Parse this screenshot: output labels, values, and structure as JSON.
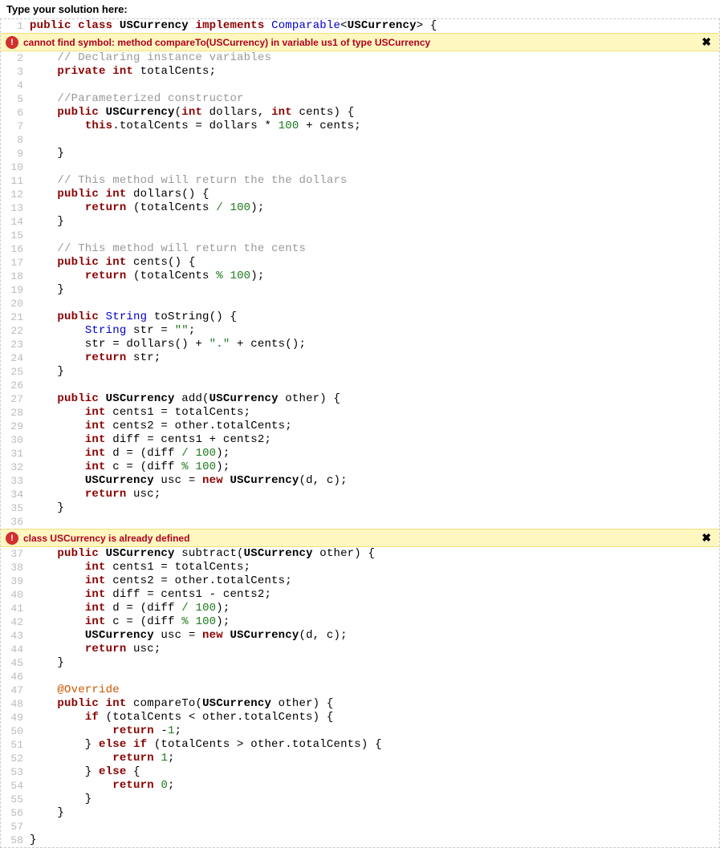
{
  "header": {
    "prompt": "Type your solution here:"
  },
  "errors": [
    {
      "message": "cannot find symbol: method compareTo(USCurrency) in variable us1 of type USCurrency",
      "after_line": 1
    },
    {
      "message": "class USCurrency is already defined",
      "after_line": 36
    }
  ],
  "close_glyph": "✖",
  "code_lines": [
    {
      "n": 1,
      "tokens": [
        [
          "kw",
          "public"
        ],
        [
          "",
          " "
        ],
        [
          "kw",
          "class"
        ],
        [
          "",
          " "
        ],
        [
          "darktyp",
          "USCurrency"
        ],
        [
          "",
          " "
        ],
        [
          "kw",
          "implements"
        ],
        [
          "",
          " "
        ],
        [
          "typ",
          "Comparable"
        ],
        [
          "",
          "<"
        ],
        [
          "darktyp",
          "USCurrency"
        ],
        [
          "",
          "> {"
        ]
      ]
    },
    {
      "n": 2,
      "tokens": [
        [
          "",
          "    "
        ],
        [
          "cmt",
          "// Declaring instance variables"
        ]
      ]
    },
    {
      "n": 3,
      "tokens": [
        [
          "",
          "    "
        ],
        [
          "kw",
          "private"
        ],
        [
          "",
          " "
        ],
        [
          "kw",
          "int"
        ],
        [
          "",
          " totalCents;"
        ]
      ]
    },
    {
      "n": 4,
      "tokens": []
    },
    {
      "n": 5,
      "tokens": [
        [
          "",
          "    "
        ],
        [
          "cmt",
          "//Parameterized constructor"
        ]
      ]
    },
    {
      "n": 6,
      "tokens": [
        [
          "",
          "    "
        ],
        [
          "kw",
          "public"
        ],
        [
          "",
          " "
        ],
        [
          "darktyp",
          "USCurrency"
        ],
        [
          "",
          "("
        ],
        [
          "kw",
          "int"
        ],
        [
          "",
          " dollars, "
        ],
        [
          "kw",
          "int"
        ],
        [
          "",
          " cents) {"
        ]
      ]
    },
    {
      "n": 7,
      "tokens": [
        [
          "",
          "        "
        ],
        [
          "kw",
          "this"
        ],
        [
          "",
          ".totalCents = dollars * "
        ],
        [
          "num",
          "100"
        ],
        [
          "",
          " + cents;"
        ]
      ]
    },
    {
      "n": 8,
      "tokens": []
    },
    {
      "n": 9,
      "tokens": [
        [
          "",
          "    }"
        ]
      ]
    },
    {
      "n": 10,
      "tokens": []
    },
    {
      "n": 11,
      "tokens": [
        [
          "",
          "    "
        ],
        [
          "cmt",
          "// This method will return the the dollars"
        ]
      ]
    },
    {
      "n": 12,
      "tokens": [
        [
          "",
          "    "
        ],
        [
          "kw",
          "public"
        ],
        [
          "",
          " "
        ],
        [
          "kw",
          "int"
        ],
        [
          "",
          " dollars() {"
        ]
      ]
    },
    {
      "n": 13,
      "tokens": [
        [
          "",
          "        "
        ],
        [
          "kw",
          "return"
        ],
        [
          "",
          " (totalCents "
        ],
        [
          "op",
          "/"
        ],
        [
          "",
          " "
        ],
        [
          "num",
          "100"
        ],
        [
          "",
          ");"
        ]
      ]
    },
    {
      "n": 14,
      "tokens": [
        [
          "",
          "    }"
        ]
      ]
    },
    {
      "n": 15,
      "tokens": []
    },
    {
      "n": 16,
      "tokens": [
        [
          "",
          "    "
        ],
        [
          "cmt",
          "// This method will return the cents"
        ]
      ]
    },
    {
      "n": 17,
      "tokens": [
        [
          "",
          "    "
        ],
        [
          "kw",
          "public"
        ],
        [
          "",
          " "
        ],
        [
          "kw",
          "int"
        ],
        [
          "",
          " cents() {"
        ]
      ]
    },
    {
      "n": 18,
      "tokens": [
        [
          "",
          "        "
        ],
        [
          "kw",
          "return"
        ],
        [
          "",
          " (totalCents "
        ],
        [
          "op",
          "%"
        ],
        [
          "",
          " "
        ],
        [
          "num",
          "100"
        ],
        [
          "",
          ");"
        ]
      ]
    },
    {
      "n": 19,
      "tokens": [
        [
          "",
          "    }"
        ]
      ]
    },
    {
      "n": 20,
      "tokens": []
    },
    {
      "n": 21,
      "tokens": [
        [
          "",
          "    "
        ],
        [
          "kw",
          "public"
        ],
        [
          "",
          " "
        ],
        [
          "typ",
          "String"
        ],
        [
          "",
          " toString() {"
        ]
      ]
    },
    {
      "n": 22,
      "tokens": [
        [
          "",
          "        "
        ],
        [
          "typ",
          "String"
        ],
        [
          "",
          " str = "
        ],
        [
          "str",
          "\"\""
        ],
        [
          "",
          ";"
        ]
      ]
    },
    {
      "n": 23,
      "tokens": [
        [
          "",
          "        str = dollars() + "
        ],
        [
          "str",
          "\".\""
        ],
        [
          "",
          " + cents();"
        ]
      ]
    },
    {
      "n": 24,
      "tokens": [
        [
          "",
          "        "
        ],
        [
          "kw",
          "return"
        ],
        [
          "",
          " str;"
        ]
      ]
    },
    {
      "n": 25,
      "tokens": [
        [
          "",
          "    }"
        ]
      ]
    },
    {
      "n": 26,
      "tokens": []
    },
    {
      "n": 27,
      "tokens": [
        [
          "",
          "    "
        ],
        [
          "kw",
          "public"
        ],
        [
          "",
          " "
        ],
        [
          "darktyp",
          "USCurrency"
        ],
        [
          "",
          " add("
        ],
        [
          "darktyp",
          "USCurrency"
        ],
        [
          "",
          " other) {"
        ]
      ]
    },
    {
      "n": 28,
      "tokens": [
        [
          "",
          "        "
        ],
        [
          "kw",
          "int"
        ],
        [
          "",
          " cents1 = totalCents;"
        ]
      ]
    },
    {
      "n": 29,
      "tokens": [
        [
          "",
          "        "
        ],
        [
          "kw",
          "int"
        ],
        [
          "",
          " cents2 = other.totalCents;"
        ]
      ]
    },
    {
      "n": 30,
      "tokens": [
        [
          "",
          "        "
        ],
        [
          "kw",
          "int"
        ],
        [
          "",
          " diff = cents1 + cents2;"
        ]
      ]
    },
    {
      "n": 31,
      "tokens": [
        [
          "",
          "        "
        ],
        [
          "kw",
          "int"
        ],
        [
          "",
          " d = (diff "
        ],
        [
          "op",
          "/"
        ],
        [
          "",
          " "
        ],
        [
          "num",
          "100"
        ],
        [
          "",
          ");"
        ]
      ]
    },
    {
      "n": 32,
      "tokens": [
        [
          "",
          "        "
        ],
        [
          "kw",
          "int"
        ],
        [
          "",
          " c = (diff "
        ],
        [
          "op",
          "%"
        ],
        [
          "",
          " "
        ],
        [
          "num",
          "100"
        ],
        [
          "",
          ");"
        ]
      ]
    },
    {
      "n": 33,
      "tokens": [
        [
          "",
          "        "
        ],
        [
          "darktyp",
          "USCurrency"
        ],
        [
          "",
          " usc = "
        ],
        [
          "kw",
          "new"
        ],
        [
          "",
          " "
        ],
        [
          "darktyp",
          "USCurrency"
        ],
        [
          "",
          "(d, c);"
        ]
      ]
    },
    {
      "n": 34,
      "tokens": [
        [
          "",
          "        "
        ],
        [
          "kw",
          "return"
        ],
        [
          "",
          " usc;"
        ]
      ]
    },
    {
      "n": 35,
      "tokens": [
        [
          "",
          "    }"
        ]
      ]
    },
    {
      "n": 36,
      "tokens": []
    },
    {
      "n": 37,
      "tokens": [
        [
          "",
          "    "
        ],
        [
          "kw",
          "public"
        ],
        [
          "",
          " "
        ],
        [
          "darktyp",
          "USCurrency"
        ],
        [
          "",
          " subtract("
        ],
        [
          "darktyp",
          "USCurrency"
        ],
        [
          "",
          " other) {"
        ]
      ]
    },
    {
      "n": 38,
      "tokens": [
        [
          "",
          "        "
        ],
        [
          "kw",
          "int"
        ],
        [
          "",
          " cents1 = totalCents;"
        ]
      ]
    },
    {
      "n": 39,
      "tokens": [
        [
          "",
          "        "
        ],
        [
          "kw",
          "int"
        ],
        [
          "",
          " cents2 = other.totalCents;"
        ]
      ]
    },
    {
      "n": 40,
      "tokens": [
        [
          "",
          "        "
        ],
        [
          "kw",
          "int"
        ],
        [
          "",
          " diff = cents1 - cents2;"
        ]
      ]
    },
    {
      "n": 41,
      "tokens": [
        [
          "",
          "        "
        ],
        [
          "kw",
          "int"
        ],
        [
          "",
          " d = (diff "
        ],
        [
          "op",
          "/"
        ],
        [
          "",
          " "
        ],
        [
          "num",
          "100"
        ],
        [
          "",
          ");"
        ]
      ]
    },
    {
      "n": 42,
      "tokens": [
        [
          "",
          "        "
        ],
        [
          "kw",
          "int"
        ],
        [
          "",
          " c = (diff "
        ],
        [
          "op",
          "%"
        ],
        [
          "",
          " "
        ],
        [
          "num",
          "100"
        ],
        [
          "",
          ");"
        ]
      ]
    },
    {
      "n": 43,
      "tokens": [
        [
          "",
          "        "
        ],
        [
          "darktyp",
          "USCurrency"
        ],
        [
          "",
          " usc = "
        ],
        [
          "kw",
          "new"
        ],
        [
          "",
          " "
        ],
        [
          "darktyp",
          "USCurrency"
        ],
        [
          "",
          "(d, c);"
        ]
      ]
    },
    {
      "n": 44,
      "tokens": [
        [
          "",
          "        "
        ],
        [
          "kw",
          "return"
        ],
        [
          "",
          " usc;"
        ]
      ]
    },
    {
      "n": 45,
      "tokens": [
        [
          "",
          "    }"
        ]
      ]
    },
    {
      "n": 46,
      "tokens": []
    },
    {
      "n": 47,
      "tokens": [
        [
          "",
          "    "
        ],
        [
          "ann",
          "@Override"
        ]
      ]
    },
    {
      "n": 48,
      "tokens": [
        [
          "",
          "    "
        ],
        [
          "kw",
          "public"
        ],
        [
          "",
          " "
        ],
        [
          "kw",
          "int"
        ],
        [
          "",
          " compareTo("
        ],
        [
          "darktyp",
          "USCurrency"
        ],
        [
          "",
          " other) {"
        ]
      ]
    },
    {
      "n": 49,
      "tokens": [
        [
          "",
          "        "
        ],
        [
          "kw",
          "if"
        ],
        [
          "",
          " (totalCents < other.totalCents) {"
        ]
      ]
    },
    {
      "n": 50,
      "tokens": [
        [
          "",
          "            "
        ],
        [
          "kw",
          "return"
        ],
        [
          "",
          " -"
        ],
        [
          "num",
          "1"
        ],
        [
          "",
          ";"
        ]
      ]
    },
    {
      "n": 51,
      "tokens": [
        [
          "",
          "        } "
        ],
        [
          "kw",
          "else"
        ],
        [
          "",
          " "
        ],
        [
          "kw",
          "if"
        ],
        [
          "",
          " (totalCents > other.totalCents) {"
        ]
      ]
    },
    {
      "n": 52,
      "tokens": [
        [
          "",
          "            "
        ],
        [
          "kw",
          "return"
        ],
        [
          "",
          " "
        ],
        [
          "num",
          "1"
        ],
        [
          "",
          ";"
        ]
      ]
    },
    {
      "n": 53,
      "tokens": [
        [
          "",
          "        } "
        ],
        [
          "kw",
          "else"
        ],
        [
          "",
          " {"
        ]
      ]
    },
    {
      "n": 54,
      "tokens": [
        [
          "",
          "            "
        ],
        [
          "kw",
          "return"
        ],
        [
          "",
          " "
        ],
        [
          "num",
          "0"
        ],
        [
          "",
          ";"
        ]
      ]
    },
    {
      "n": 55,
      "tokens": [
        [
          "",
          "        }"
        ]
      ]
    },
    {
      "n": 56,
      "tokens": [
        [
          "",
          "    }"
        ]
      ]
    },
    {
      "n": 57,
      "tokens": []
    },
    {
      "n": 58,
      "tokens": [
        [
          "",
          "}"
        ]
      ]
    }
  ]
}
